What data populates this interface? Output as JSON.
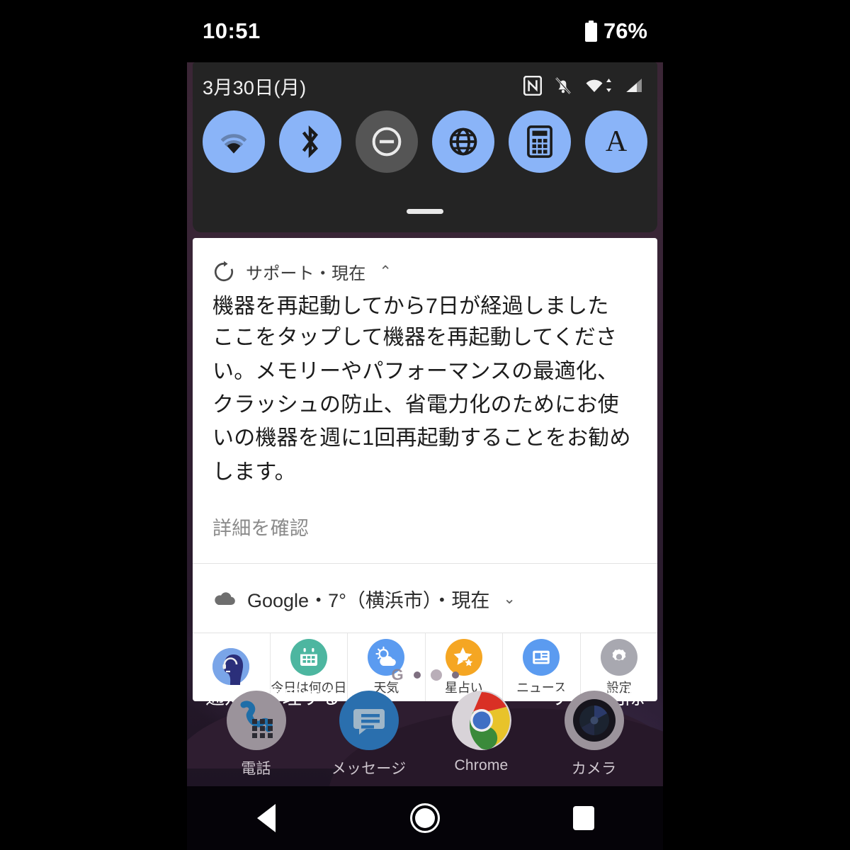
{
  "statusbar": {
    "time": "10:51",
    "battery_percent": "76%",
    "battery_icon": "battery-full-icon"
  },
  "quick_settings": {
    "date": "3月30日(月)",
    "status_icons": [
      "nfc-icon",
      "notifications-muted-icon",
      "wifi-icon",
      "cellular-signal-icon"
    ],
    "accent_on": "#8ab4f8",
    "accent_off": "#555555",
    "tiles": [
      {
        "name": "wifi-tile",
        "icon": "wifi-icon",
        "state": "on"
      },
      {
        "name": "bluetooth-tile",
        "icon": "bluetooth-icon",
        "state": "on"
      },
      {
        "name": "do-not-disturb-tile",
        "icon": "do-not-disturb-icon",
        "state": "off"
      },
      {
        "name": "mobile-data-tile",
        "icon": "globe-icon",
        "state": "on"
      },
      {
        "name": "calculator-tile",
        "icon": "calculator-icon",
        "state": "on"
      },
      {
        "name": "auto-rotate-tile",
        "icon": "font-size-a-icon",
        "state": "on",
        "label": "A"
      }
    ],
    "handle": "drag-handle"
  },
  "notification": {
    "app_icon": "restart-refresh-icon",
    "app_label": "サポート・現在",
    "collapse_chevron": "⌃",
    "title": "機器を再起動してから7日が経過しました",
    "text": "ここをタップして機器を再起動してください。メモリーやパフォーマンスの最適化、クラッシュの防止、省電力化のためにお使いの機器を週に1回再起動することをお勧めします。",
    "link": "詳細を確認"
  },
  "weather": {
    "icon": "cloud-icon",
    "text": "Google・7°（横浜市）・現在",
    "expand_chevron": "⌄"
  },
  "shortcuts": [
    {
      "name": "support-agent",
      "label": "",
      "icon": "support-agent-icon",
      "color": "#7aa5e8"
    },
    {
      "name": "today-what-day",
      "label": "今日は何の日",
      "icon": "calendar-icon",
      "color": "#4db6a0"
    },
    {
      "name": "weather",
      "label": "天気",
      "icon": "sun-cloud-icon",
      "color": "#5b9bf0"
    },
    {
      "name": "horoscope",
      "label": "星占い",
      "icon": "star-icon",
      "color": "#f5a623"
    },
    {
      "name": "news",
      "label": "ニュース",
      "icon": "newspaper-icon",
      "color": "#5b9bf0"
    },
    {
      "name": "settings",
      "label": "設定",
      "icon": "gear-icon",
      "color": "#a8a8b0"
    }
  ],
  "page_indicator": {
    "google_glyph": "G",
    "dots": 3,
    "active_index": 1
  },
  "shade_actions": {
    "manage": "通知を管理する",
    "clear_all": "すべて削除"
  },
  "dock": [
    {
      "name": "phone",
      "label": "電話",
      "icon": "phone-dialer-icon"
    },
    {
      "name": "messages",
      "label": "メッセージ",
      "icon": "message-icon"
    },
    {
      "name": "chrome",
      "label": "Chrome",
      "icon": "chrome-icon"
    },
    {
      "name": "camera",
      "label": "カメラ",
      "icon": "camera-icon"
    }
  ],
  "navbar": {
    "back": "back-icon",
    "home": "home-icon",
    "recents": "recents-icon"
  }
}
